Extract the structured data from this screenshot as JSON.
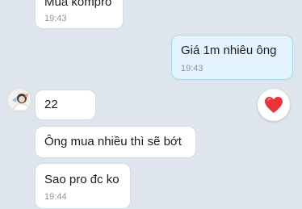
{
  "messages": [
    {
      "id": "m1",
      "direction": "incoming",
      "text": "Mua kompro",
      "time": "19:43"
    },
    {
      "id": "m2",
      "direction": "outgoing",
      "text": "Giá 1m nhiêu ông",
      "time": "19:43"
    },
    {
      "id": "m3",
      "direction": "incoming",
      "text": "22",
      "time": ""
    },
    {
      "id": "m4",
      "direction": "incoming",
      "text": "Ông mua nhiều thì sẽ bớt",
      "time": ""
    },
    {
      "id": "m5",
      "direction": "incoming",
      "text": "Sao pro đc ko",
      "time": "19:44"
    }
  ],
  "reaction": {
    "icon": "heart-icon",
    "color": "#e8343b"
  },
  "avatar": {
    "icon": "avatar-image"
  },
  "colors": {
    "background": "#dfe5ec",
    "incoming_bubble": "#ffffff",
    "outgoing_bubble": "#e3f3fd",
    "timestamp": "#8d969e"
  }
}
